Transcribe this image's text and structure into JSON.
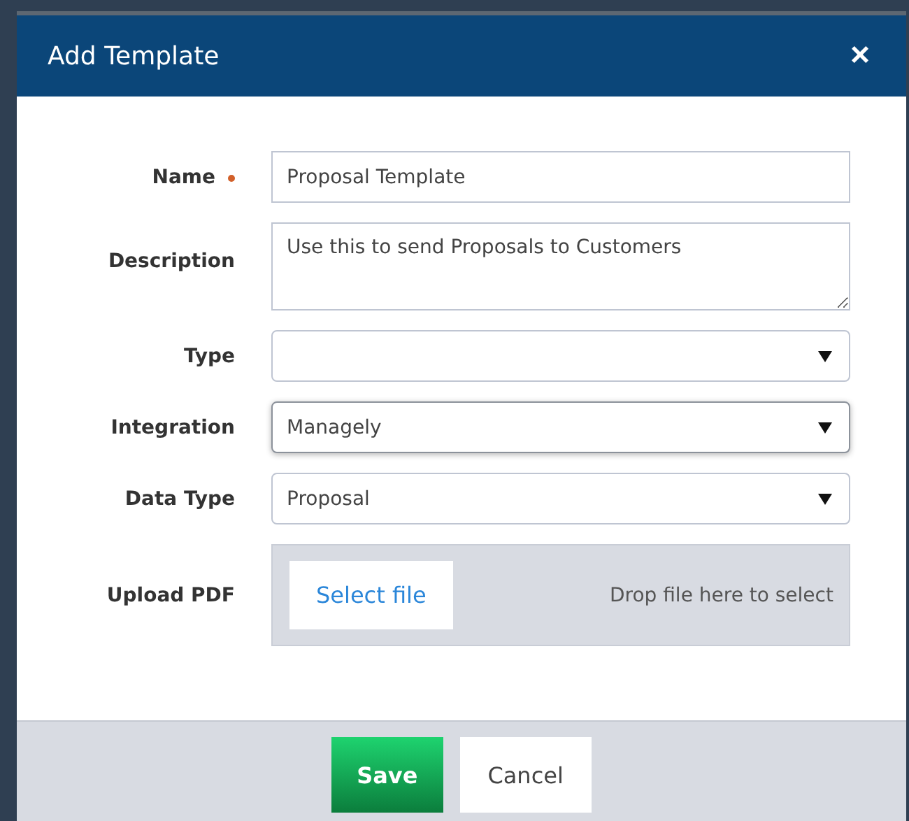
{
  "dialog": {
    "title": "Add Template",
    "close": "×"
  },
  "fields": [
    {
      "kind": "text",
      "label": "Name",
      "required": true,
      "focused": false,
      "value": "Proposal Template"
    },
    {
      "kind": "textarea",
      "label": "Description",
      "required": false,
      "focused": false,
      "value": "Use this to send Proposals to Customers"
    },
    {
      "kind": "select",
      "label": "Type",
      "required": false,
      "focused": false
    },
    {
      "kind": "select",
      "label": "Integration",
      "required": false,
      "focused": true,
      "value": "Managely"
    },
    {
      "kind": "select",
      "label": "Data Type",
      "required": false,
      "focused": false,
      "value": "Proposal"
    },
    {
      "kind": "upload",
      "label": "Upload PDF",
      "required": false,
      "focused": false,
      "button": "Select file",
      "hint": "Drop file here to select"
    }
  ],
  "buttons": [
    {
      "kind": "primary",
      "label": "Save"
    },
    {
      "kind": "secondary",
      "label": "Cancel"
    }
  ]
}
